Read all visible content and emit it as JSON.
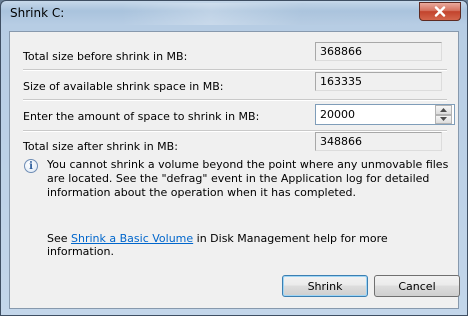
{
  "window": {
    "title": "Shrink C:"
  },
  "fields": {
    "total_before": {
      "label": "Total size before shrink in MB:",
      "value": "368866"
    },
    "available": {
      "label": "Size of available shrink space in MB:",
      "value": "163335"
    },
    "amount": {
      "label": "Enter the amount of space to shrink in MB:",
      "value": "20000"
    },
    "total_after": {
      "label": "Total size after shrink in MB:",
      "value": "348866"
    }
  },
  "info": {
    "text": "You cannot shrink a volume beyond the point where any unmovable files are located. See the \"defrag\" event in the Application log for detailed information about the operation when it has completed."
  },
  "help": {
    "prefix": "See ",
    "link": "Shrink a Basic Volume",
    "suffix": " in Disk Management help for more information."
  },
  "buttons": {
    "shrink": "Shrink",
    "cancel": "Cancel"
  },
  "icons": {
    "close": "close-icon",
    "info": "info-icon",
    "spin_up": "chevron-up-icon",
    "spin_down": "chevron-down-icon"
  },
  "colors": {
    "link": "#0066cc",
    "close_button": "#c2432c",
    "dialog_bg": "#f0f0f0"
  }
}
